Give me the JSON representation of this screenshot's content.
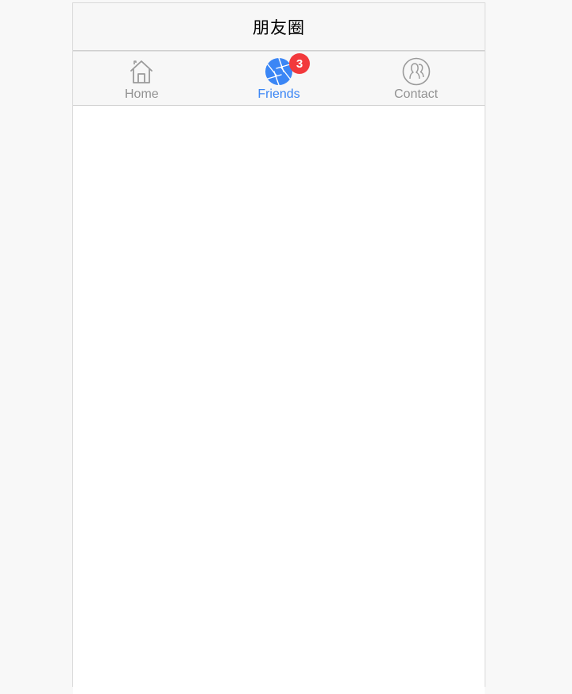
{
  "navbar": {
    "title": "朋友圈"
  },
  "tabbar": {
    "tabs": [
      {
        "label": "Home",
        "icon": "home-icon",
        "active": false
      },
      {
        "label": "Friends",
        "icon": "aperture-icon",
        "active": true,
        "badge": "3"
      },
      {
        "label": "Contact",
        "icon": "contacts-icon",
        "active": false
      }
    ]
  },
  "colors": {
    "accent": "#3b86f5",
    "badge": "#f2393c",
    "inactive": "#929292",
    "bar_background": "#f7f7f7"
  }
}
